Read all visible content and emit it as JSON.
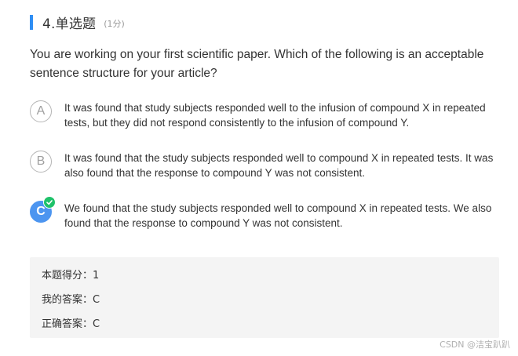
{
  "question": {
    "number_title": "4.单选题",
    "score": "(1分)",
    "stem": "You are working on your first scientific paper. Which of the following is an acceptable sentence structure for your article?"
  },
  "options": [
    {
      "letter": "A",
      "text": "It was found that study subjects responded well to the infusion of compound X in repeated tests, but they did not respond consistently to the infusion of compound Y.",
      "selected": false
    },
    {
      "letter": "B",
      "text": "It was found that the study subjects responded well to compound X in repeated tests. It was also found that the response to compound Y was not consistent.",
      "selected": false
    },
    {
      "letter": "C",
      "text": "We found that the study subjects responded well to compound X in repeated tests. We also found that the response to compound Y was not consistent.",
      "selected": true
    }
  ],
  "result": {
    "score_line": "本题得分：1",
    "my_answer_line": "我的答案：C",
    "correct_answer_line": "正确答案：C"
  },
  "watermark": "CSDN @洁宝趴趴",
  "colors": {
    "accent": "#2f8ef4",
    "selected_option": "#4c95f0",
    "correct_badge": "#1fc26a",
    "answer_panel": "#f4f4f4"
  }
}
